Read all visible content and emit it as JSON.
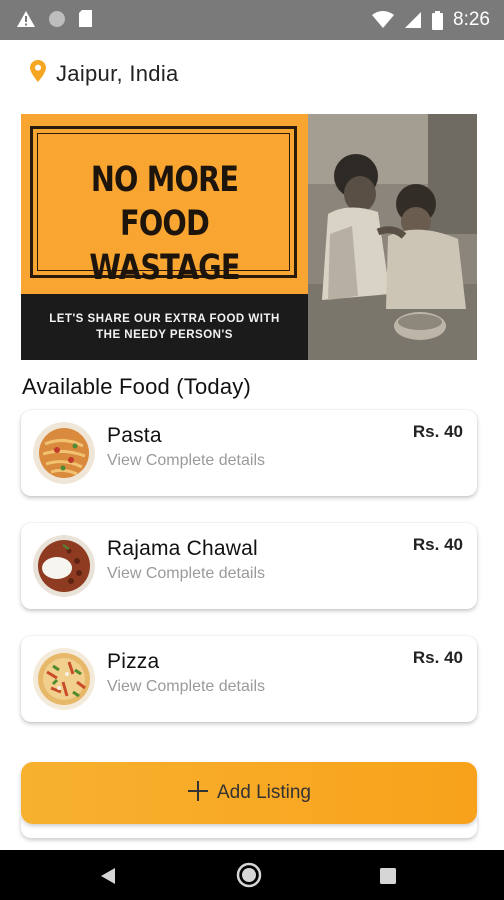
{
  "status_bar": {
    "time": "8:26"
  },
  "location": {
    "icon": "location-pin-icon",
    "text": "Jaipur, India",
    "icon_color": "#f5a623"
  },
  "banner": {
    "headline_line1": "NO MORE FOOD",
    "headline_line2": "WASTAGE",
    "subline1": "LET'S SHARE OUR EXTRA FOOD WITH",
    "subline2": "THE NEEDY PERSON'S",
    "accent": "#f8a531"
  },
  "section": {
    "title": "Available Food (Today)"
  },
  "food_items": [
    {
      "name": "Pasta",
      "details": "View Complete details",
      "price": "Rs. 40"
    },
    {
      "name": "Rajama Chawal",
      "details": "View Complete details",
      "price": "Rs. 40"
    },
    {
      "name": "Pizza",
      "details": "View Complete details",
      "price": "Rs. 40"
    }
  ],
  "add_button": {
    "label": "Add Listing",
    "icon": "plus-icon",
    "color": "#f8a21b"
  }
}
